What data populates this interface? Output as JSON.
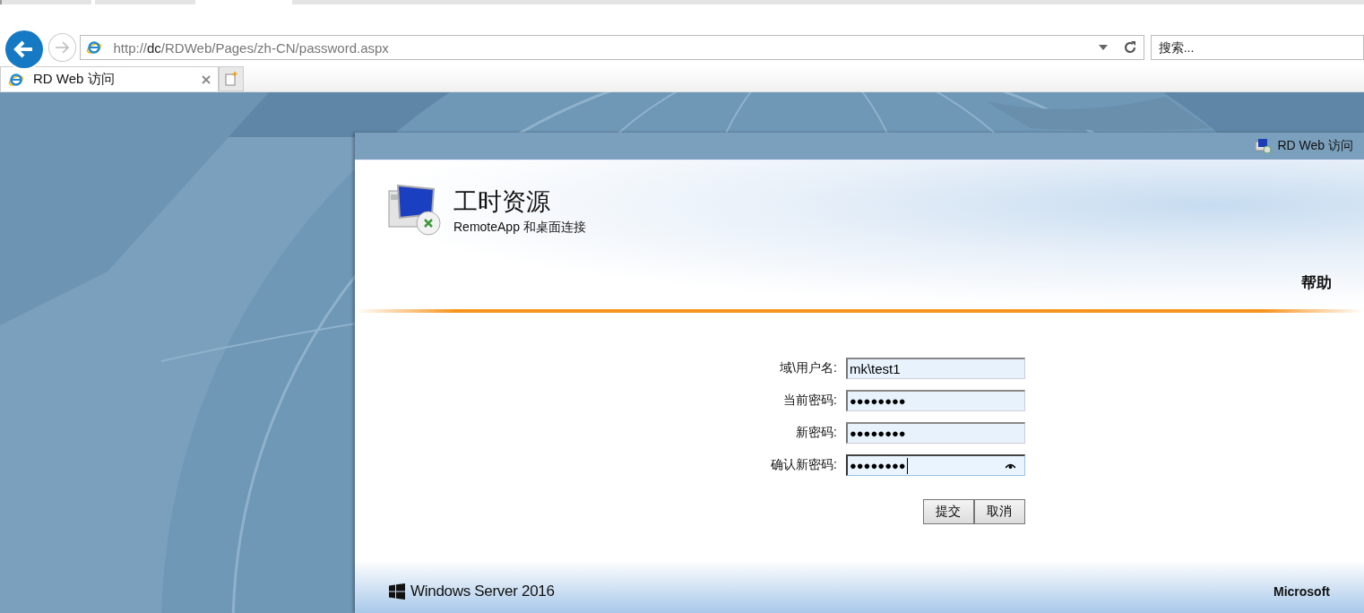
{
  "browser": {
    "address": "http://**dc**/RDWeb/Pages/zh-CN/password.aspx",
    "search": {
      "placeholder": "搜索..."
    },
    "tabs": [
      {
        "title": "RD Web 访问",
        "selected": true
      }
    ]
  },
  "page": {
    "top_bar_title": "RD Web 访问",
    "heading": "工时资源",
    "subheading": "RemoteApp 和桌面连接",
    "help_link": "帮助",
    "fields": [
      {
        "label": "域\\用户名:",
        "value": "mk\\test1",
        "kind": "text",
        "focused": false
      },
      {
        "label": "当前密码:",
        "value": "●●●●●●●●",
        "kind": "password",
        "focused": false
      },
      {
        "label": "新密码:",
        "value": "●●●●●●●●",
        "kind": "password",
        "focused": false
      },
      {
        "label": "确认新密码:",
        "value": "●●●●●●●●",
        "kind": "password",
        "focused": true
      }
    ],
    "buttons": [
      "提交",
      "取消"
    ],
    "footer": {
      "product": "Windows Server 2016",
      "brand": "Microsoft"
    }
  }
}
